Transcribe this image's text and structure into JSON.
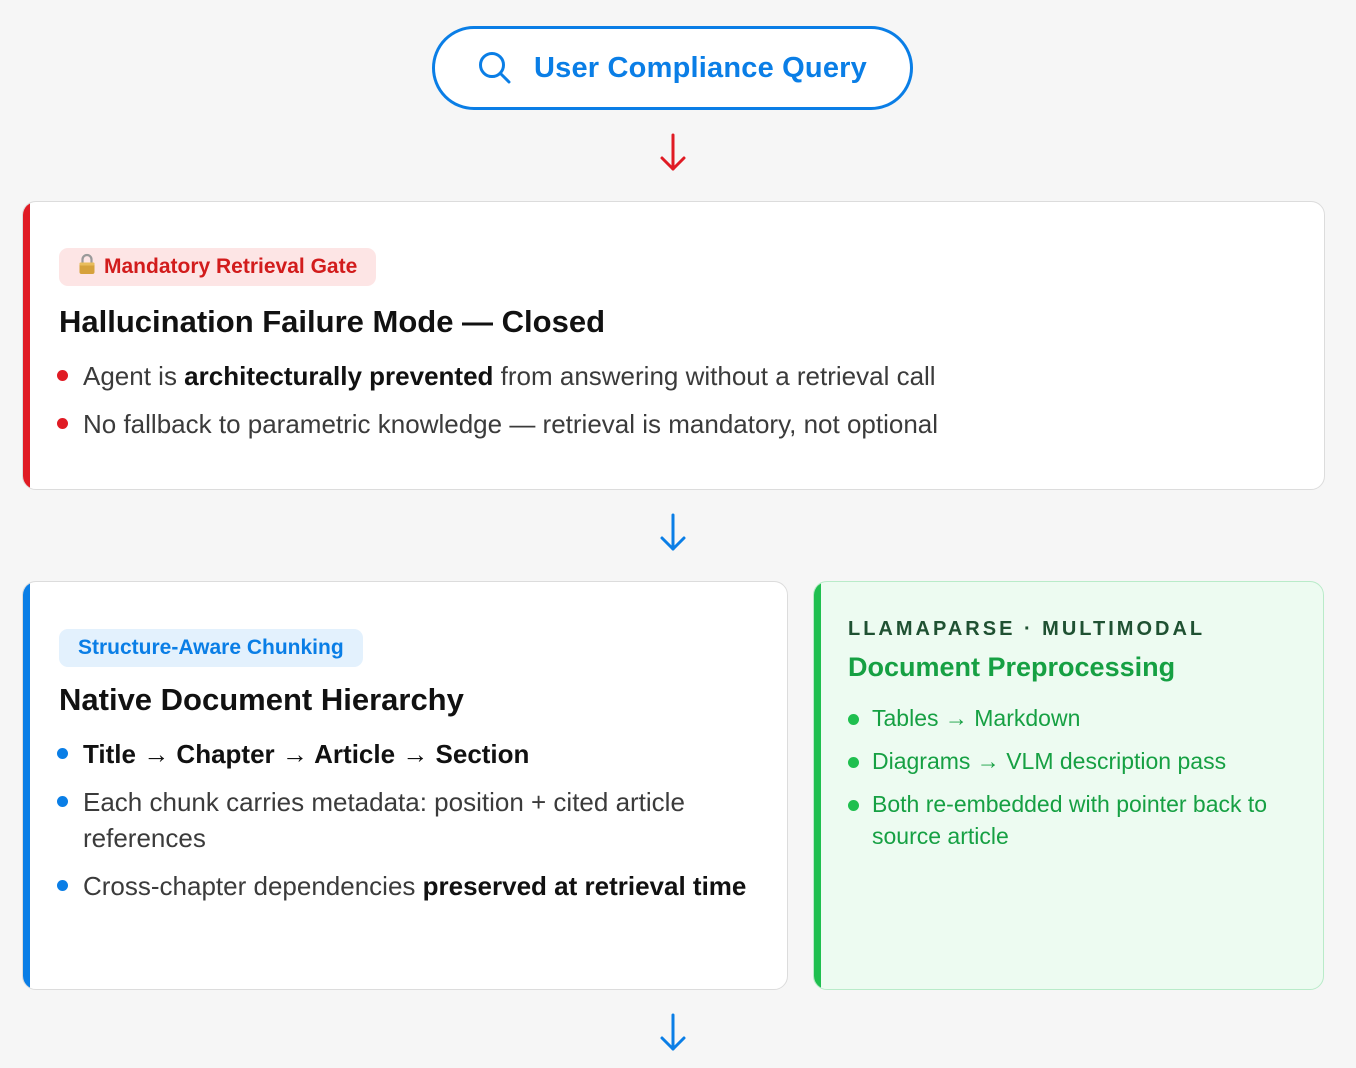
{
  "query": {
    "label": "User Compliance Query",
    "icon": "search-icon"
  },
  "colors": {
    "blue": "#0a7ee6",
    "red": "#e01b24",
    "green": "#16a043",
    "green_bg": "#edfbf1"
  },
  "gate": {
    "badge_icon": "lock-icon",
    "badge_label": "Mandatory Retrieval Gate",
    "title": "Hallucination Failure Mode — Closed",
    "bullets": [
      {
        "pre": "Agent is ",
        "bold": "architecturally prevented",
        "post": " from answering without a retrieval call"
      },
      {
        "text": "No fallback to parametric knowledge — retrieval is mandatory, not optional"
      }
    ]
  },
  "chunking": {
    "badge_label": "Structure-Aware Chunking",
    "title": "Native Document Hierarchy",
    "bullets": [
      {
        "text": "Title → Chapter → Article → Section"
      },
      {
        "text": "Each chunk carries metadata: position + cited article references"
      },
      {
        "pre": "Cross-chapter dependencies ",
        "bold": "preserved at retrieval time"
      }
    ]
  },
  "preprocessing": {
    "eyebrow": "LLAMAPARSE · MULTIMODAL",
    "title": "Document Preprocessing",
    "bullets": [
      "Tables → Markdown",
      "Diagrams → VLM description pass",
      "Both re-embedded with pointer back to source article"
    ]
  }
}
